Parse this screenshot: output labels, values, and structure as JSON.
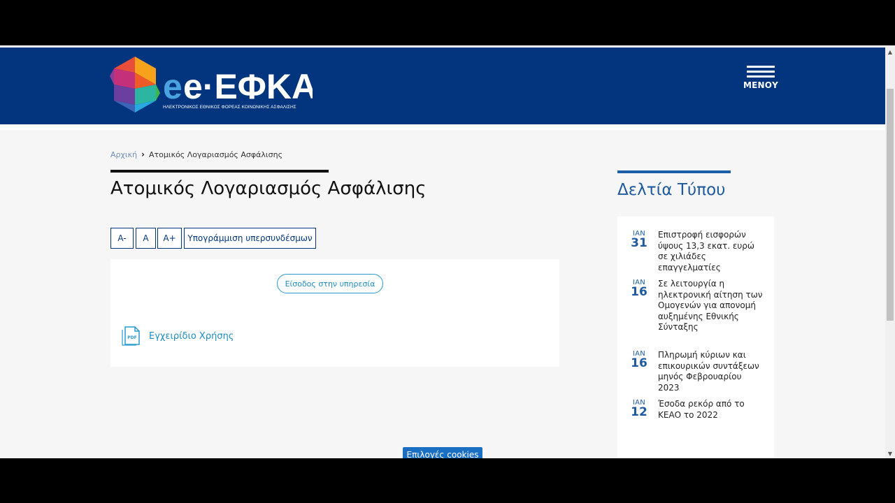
{
  "header": {
    "logo_main": "e·ΕΦΚΑ",
    "logo_subtitle": "ΗΛΕΚΤΡΟΝΙΚΟΣ ΕΘΝΙΚΟΣ ΦΟΡΕΑΣ ΚΟΙΝΩΝΙΚΗΣ ΑΣΦΑΛΙΣΗΣ",
    "menu_label": "ΜΕΝΟΥ"
  },
  "breadcrumb": {
    "home": "Αρχική",
    "current": "Ατομικός Λογαριασμός Ασφάλισης"
  },
  "page": {
    "title": "Ατομικός Λογαριασμός Ασφάλισης"
  },
  "font_controls": {
    "decrease": "A-",
    "normal": "A",
    "increase": "A+",
    "underline_links": "Υπογράμμιση υπερσυνδέσμων"
  },
  "card": {
    "login_button": "Είσοδος στην υπηρεσία",
    "pdf_icon_text": "PDF",
    "manual_link": "Εγχειρίδιο Χρήσης"
  },
  "sidebar": {
    "title": "Δελτία Τύπου",
    "news": [
      {
        "month": "ΙΑΝ",
        "day": "31",
        "text": "Επιστροφή εισφορών ύψους 13,3 εκατ. ευρώ σε χιλιάδες επαγγελματίες"
      },
      {
        "month": "ΙΑΝ",
        "day": "16",
        "text": "Σε λειτουργία η ηλεκτρονική αίτηση των Ομογενών για απονομή αυξημένης Εθνικής Σύνταξης"
      },
      {
        "month": "ΙΑΝ",
        "day": "16",
        "text": "Πληρωμή κύριων και επικουρικών συντάξεων μηνός Φεβρουαρίου 2023"
      },
      {
        "month": "ΙΑΝ",
        "day": "12",
        "text": "Έσοδα ρεκόρ από το ΚΕΑΟ το 2022"
      }
    ]
  },
  "cookies": {
    "label": "Επιλογές cookies"
  },
  "colors": {
    "header_bg": "#02357d",
    "accent_blue": "#1f5a9e",
    "link_blue": "#1a8cc4",
    "cookies_bg": "#1b6fc2"
  },
  "icons": {
    "menu": "hamburger-icon",
    "breadcrumb_sep": "chevron-right-icon",
    "pdf": "pdf-file-icon",
    "scroll_up": "arrow-up-icon",
    "scroll_down": "arrow-down-icon"
  }
}
